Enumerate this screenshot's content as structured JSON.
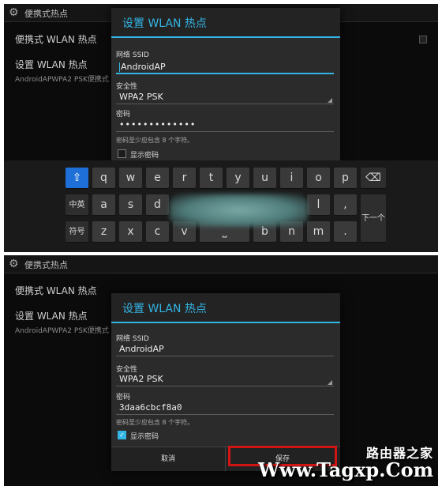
{
  "top_panel": {
    "status_title": "便携式热点",
    "settings_rows": [
      {
        "label": "便携式 WLAN 热点",
        "sub": ""
      },
      {
        "label": "设置 WLAN 热点",
        "sub": "AndroidAPWPA2 PSK便携式 WLAN"
      }
    ],
    "dialog": {
      "title": "设置 WLAN 热点",
      "ssid_label": "网络 SSID",
      "ssid_value": "AndroidAP",
      "security_label": "安全性",
      "security_value": "WPA2 PSK",
      "password_label": "密码",
      "password_value": "•••••••••••••",
      "hint": "密码至少应包含 8 个字符。",
      "show_password_label": "显示密码",
      "show_password_checked": false
    },
    "keyboard": {
      "row1": [
        "q",
        "w",
        "e",
        "r",
        "t",
        "y",
        "u",
        "i",
        "o",
        "p"
      ],
      "row2": [
        "a",
        "s",
        "d",
        "l",
        ","
      ],
      "row3": [
        "z",
        "x",
        "c",
        "v",
        "b",
        "n",
        "m",
        "."
      ],
      "lang_key": "中英",
      "symbol_key": "符号",
      "space_key": "⎵",
      "next_key": "下一个"
    }
  },
  "bottom_panel": {
    "status_title": "便携式热点",
    "settings_rows": [
      {
        "label": "便携式 WLAN 热点",
        "sub": ""
      },
      {
        "label": "设置 WLAN 热点",
        "sub": "AndroidAPWPA2 PSK便携式 WLAN"
      }
    ],
    "dialog": {
      "title": "设置 WLAN 热点",
      "ssid_label": "网络 SSID",
      "ssid_value": "AndroidAP",
      "security_label": "安全性",
      "security_value": "WPA2 PSK",
      "password_label": "密码",
      "password_value": "3daa6cbcf8a0",
      "hint": "密码至少应包含 8 个字符。",
      "show_password_label": "显示密码",
      "show_password_checked": true,
      "cancel_label": "取消",
      "save_label": "保存"
    }
  },
  "watermark": {
    "cn": "路由器之家",
    "url": "Www.Tagxp.Com"
  },
  "colors": {
    "accent": "#33b5e5",
    "highlight": "#d11414",
    "shift_key": "#1e6fd8"
  }
}
